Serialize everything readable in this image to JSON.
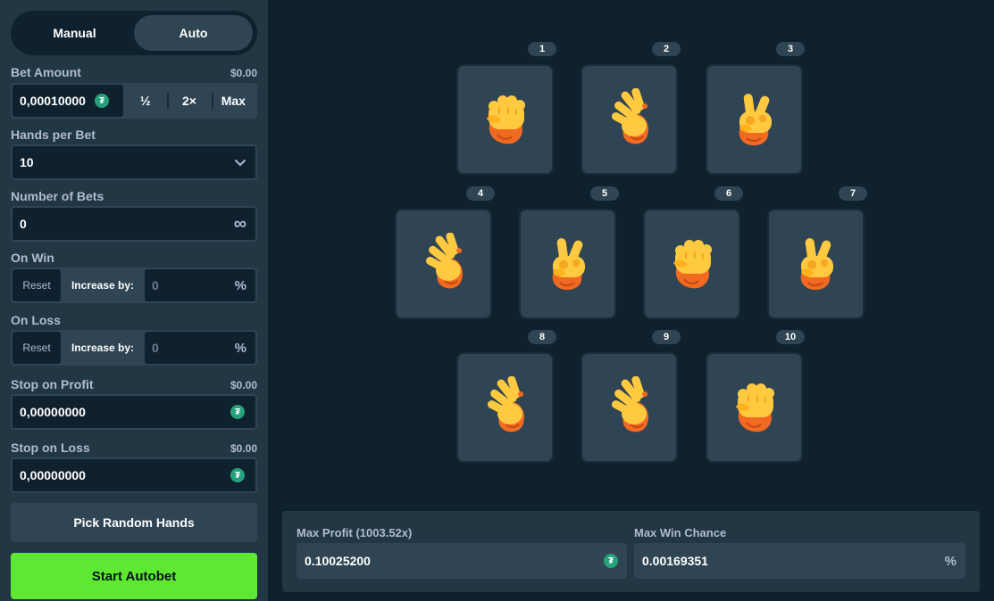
{
  "mode_tabs": {
    "manual": "Manual",
    "auto": "Auto",
    "active": "auto"
  },
  "bet_amount": {
    "label": "Bet Amount",
    "usd": "$0.00",
    "value": "0,00010000",
    "half": "½",
    "double": "2×",
    "max": "Max"
  },
  "hands_per_bet": {
    "label": "Hands per Bet",
    "value": "10"
  },
  "number_of_bets": {
    "label": "Number of Bets",
    "value": "0",
    "infinity_icon": "∞"
  },
  "on_win": {
    "label": "On Win",
    "reset": "Reset",
    "increase_label": "Increase by:",
    "value": "0",
    "unit": "%"
  },
  "on_loss": {
    "label": "On Loss",
    "reset": "Reset",
    "increase_label": "Increase by:",
    "value": "0",
    "unit": "%"
  },
  "stop_on_profit": {
    "label": "Stop on Profit",
    "usd": "$0.00",
    "value": "0,00000000"
  },
  "stop_on_loss": {
    "label": "Stop on Loss",
    "usd": "$0.00",
    "value": "0,00000000"
  },
  "pick_random_label": "Pick Random Hands",
  "start_autobet_label": "Start Autobet",
  "currency_icon": "tether-icon",
  "coin_glyph": "₮",
  "colors": {
    "bg": "#0f212e",
    "sidebar": "#213743",
    "card": "#2f4553",
    "accent_green": "#5fe831",
    "label": "#b1bad3",
    "hand_orange": "#f26a21",
    "hand_yellow": "#ffc940"
  },
  "hands": [
    {
      "num": "1",
      "type": "rock"
    },
    {
      "num": "2",
      "type": "paper"
    },
    {
      "num": "3",
      "type": "scissors"
    },
    {
      "num": "4",
      "type": "paper"
    },
    {
      "num": "5",
      "type": "scissors"
    },
    {
      "num": "6",
      "type": "rock"
    },
    {
      "num": "7",
      "type": "scissors"
    },
    {
      "num": "8",
      "type": "paper"
    },
    {
      "num": "9",
      "type": "paper"
    },
    {
      "num": "10",
      "type": "rock"
    }
  ],
  "stats": {
    "max_profit_label": "Max Profit (1003.52x)",
    "max_profit_value": "0.10025200",
    "max_win_chance_label": "Max Win Chance",
    "max_win_chance_value": "0.00169351",
    "percent": "%"
  }
}
